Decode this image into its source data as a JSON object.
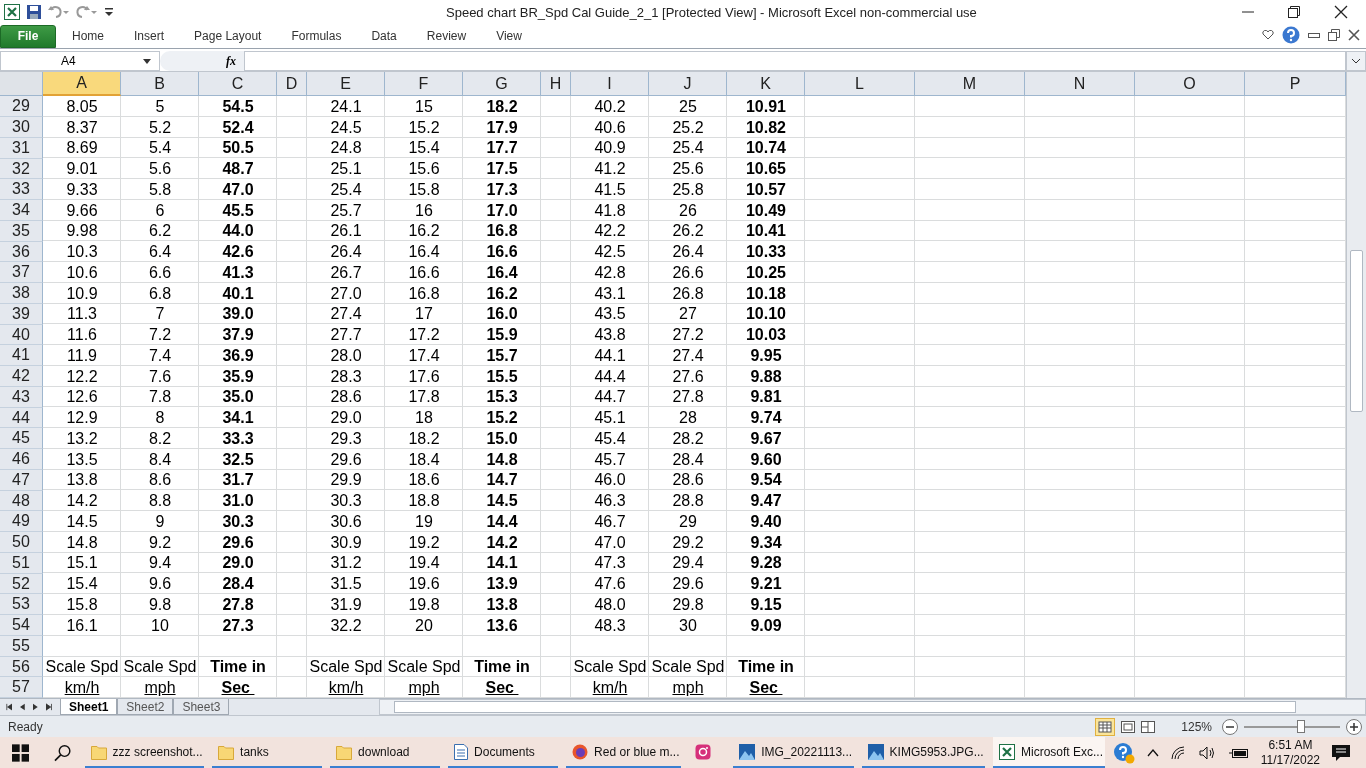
{
  "window": {
    "title": "Speed chart BR_Spd Cal Guide_2_1  [Protected View]  -  Microsoft Excel non-commercial use"
  },
  "ribbon_tabs": [
    {
      "label": "File",
      "kind": "file"
    },
    {
      "label": "Home",
      "kind": "tab"
    },
    {
      "label": "Insert",
      "kind": "tab"
    },
    {
      "label": "Page Layout",
      "kind": "tab"
    },
    {
      "label": "Formulas",
      "kind": "tab"
    },
    {
      "label": "Data",
      "kind": "tab"
    },
    {
      "label": "Review",
      "kind": "tab"
    },
    {
      "label": "View",
      "kind": "tab"
    }
  ],
  "formula_bar": {
    "name_box": "A4",
    "fx": "fx"
  },
  "columns": [
    {
      "label": "A",
      "selected": true
    },
    {
      "label": "B",
      "selected": false
    },
    {
      "label": "C",
      "selected": false
    },
    {
      "label": "D",
      "selected": false
    },
    {
      "label": "E",
      "selected": false
    },
    {
      "label": "F",
      "selected": false
    },
    {
      "label": "G",
      "selected": false
    },
    {
      "label": "H",
      "selected": false
    },
    {
      "label": "I",
      "selected": false
    },
    {
      "label": "J",
      "selected": false
    },
    {
      "label": "K",
      "selected": false
    },
    {
      "label": "L",
      "selected": false
    },
    {
      "label": "M",
      "selected": false
    },
    {
      "label": "N",
      "selected": false
    },
    {
      "label": "O",
      "selected": false
    },
    {
      "label": "P",
      "selected": false
    }
  ],
  "rows": [
    {
      "number": "29",
      "cells": [
        "8.05",
        "5",
        "54.5",
        "24.1",
        "15",
        "18.2",
        "40.2",
        "25",
        "10.91"
      ]
    },
    {
      "number": "30",
      "cells": [
        "8.37",
        "5.2",
        "52.4",
        "24.5",
        "15.2",
        "17.9",
        "40.6",
        "25.2",
        "10.82"
      ]
    },
    {
      "number": "31",
      "cells": [
        "8.69",
        "5.4",
        "50.5",
        "24.8",
        "15.4",
        "17.7",
        "40.9",
        "25.4",
        "10.74"
      ]
    },
    {
      "number": "32",
      "cells": [
        "9.01",
        "5.6",
        "48.7",
        "25.1",
        "15.6",
        "17.5",
        "41.2",
        "25.6",
        "10.65"
      ]
    },
    {
      "number": "33",
      "cells": [
        "9.33",
        "5.8",
        "47.0",
        "25.4",
        "15.8",
        "17.3",
        "41.5",
        "25.8",
        "10.57"
      ]
    },
    {
      "number": "34",
      "cells": [
        "9.66",
        "6",
        "45.5",
        "25.7",
        "16",
        "17.0",
        "41.8",
        "26",
        "10.49"
      ]
    },
    {
      "number": "35",
      "cells": [
        "9.98",
        "6.2",
        "44.0",
        "26.1",
        "16.2",
        "16.8",
        "42.2",
        "26.2",
        "10.41"
      ]
    },
    {
      "number": "36",
      "cells": [
        "10.3",
        "6.4",
        "42.6",
        "26.4",
        "16.4",
        "16.6",
        "42.5",
        "26.4",
        "10.33"
      ]
    },
    {
      "number": "37",
      "cells": [
        "10.6",
        "6.6",
        "41.3",
        "26.7",
        "16.6",
        "16.4",
        "42.8",
        "26.6",
        "10.25"
      ]
    },
    {
      "number": "38",
      "cells": [
        "10.9",
        "6.8",
        "40.1",
        "27.0",
        "16.8",
        "16.2",
        "43.1",
        "26.8",
        "10.18"
      ]
    },
    {
      "number": "39",
      "cells": [
        "11.3",
        "7",
        "39.0",
        "27.4",
        "17",
        "16.0",
        "43.5",
        "27",
        "10.10"
      ]
    },
    {
      "number": "40",
      "cells": [
        "11.6",
        "7.2",
        "37.9",
        "27.7",
        "17.2",
        "15.9",
        "43.8",
        "27.2",
        "10.03"
      ]
    },
    {
      "number": "41",
      "cells": [
        "11.9",
        "7.4",
        "36.9",
        "28.0",
        "17.4",
        "15.7",
        "44.1",
        "27.4",
        "9.95"
      ]
    },
    {
      "number": "42",
      "cells": [
        "12.2",
        "7.6",
        "35.9",
        "28.3",
        "17.6",
        "15.5",
        "44.4",
        "27.6",
        "9.88"
      ]
    },
    {
      "number": "43",
      "cells": [
        "12.6",
        "7.8",
        "35.0",
        "28.6",
        "17.8",
        "15.3",
        "44.7",
        "27.8",
        "9.81"
      ]
    },
    {
      "number": "44",
      "cells": [
        "12.9",
        "8",
        "34.1",
        "29.0",
        "18",
        "15.2",
        "45.1",
        "28",
        "9.74"
      ]
    },
    {
      "number": "45",
      "cells": [
        "13.2",
        "8.2",
        "33.3",
        "29.3",
        "18.2",
        "15.0",
        "45.4",
        "28.2",
        "9.67"
      ]
    },
    {
      "number": "46",
      "cells": [
        "13.5",
        "8.4",
        "32.5",
        "29.6",
        "18.4",
        "14.8",
        "45.7",
        "28.4",
        "9.60"
      ]
    },
    {
      "number": "47",
      "cells": [
        "13.8",
        "8.6",
        "31.7",
        "29.9",
        "18.6",
        "14.7",
        "46.0",
        "28.6",
        "9.54"
      ]
    },
    {
      "number": "48",
      "cells": [
        "14.2",
        "8.8",
        "31.0",
        "30.3",
        "18.8",
        "14.5",
        "46.3",
        "28.8",
        "9.47"
      ]
    },
    {
      "number": "49",
      "cells": [
        "14.5",
        "9",
        "30.3",
        "30.6",
        "19",
        "14.4",
        "46.7",
        "29",
        "9.40"
      ]
    },
    {
      "number": "50",
      "cells": [
        "14.8",
        "9.2",
        "29.6",
        "30.9",
        "19.2",
        "14.2",
        "47.0",
        "29.2",
        "9.34"
      ]
    },
    {
      "number": "51",
      "cells": [
        "15.1",
        "9.4",
        "29.0",
        "31.2",
        "19.4",
        "14.1",
        "47.3",
        "29.4",
        "9.28"
      ]
    },
    {
      "number": "52",
      "cells": [
        "15.4",
        "9.6",
        "28.4",
        "31.5",
        "19.6",
        "13.9",
        "47.6",
        "29.6",
        "9.21"
      ]
    },
    {
      "number": "53",
      "cells": [
        "15.8",
        "9.8",
        "27.8",
        "31.9",
        "19.8",
        "13.8",
        "48.0",
        "29.8",
        "9.15"
      ]
    },
    {
      "number": "54",
      "cells": [
        "16.1",
        "10",
        "27.3",
        "32.2",
        "20",
        "13.6",
        "48.3",
        "30",
        "9.09"
      ]
    },
    {
      "number": "55",
      "cells": []
    },
    {
      "number": "56",
      "underlined": false,
      "cells": [
        "Scale Spd",
        "Scale Spd",
        "Time in",
        "Scale Spd",
        "Scale Spd",
        "Time in",
        "Scale Spd",
        "Scale Spd",
        "Time in"
      ]
    },
    {
      "number": "57",
      "underlined": true,
      "cells": [
        "km/h",
        "mph",
        "Sec ",
        "km/h",
        "mph",
        "Sec ",
        "km/h",
        "mph",
        "Sec "
      ]
    }
  ],
  "sheet_tabs": [
    {
      "label": "Sheet1",
      "selected": true
    },
    {
      "label": "Sheet2",
      "selected": false
    },
    {
      "label": "Sheet3",
      "selected": false
    }
  ],
  "status_bar": {
    "status": "Ready",
    "zoom": "125%",
    "zoom_slider": {
      "level": 0.59
    }
  },
  "taskbar": {
    "items": [
      {
        "label": "zzz screenshot...",
        "kind": "folder",
        "selected": false
      },
      {
        "label": "tanks",
        "kind": "folder",
        "selected": false
      },
      {
        "label": "download",
        "kind": "folder",
        "selected": false
      },
      {
        "label": "Documents",
        "kind": "document",
        "selected": false
      },
      {
        "label": "Red or blue m...",
        "kind": "browser",
        "selected": false
      },
      {
        "kind": "camera",
        "selected": false
      },
      {
        "label": "IMG_20221113...",
        "kind": "image",
        "selected": false
      },
      {
        "label": "KIMG5953.JPG...",
        "kind": "image",
        "selected": false
      },
      {
        "label": "Microsoft Exc...",
        "kind": "excel",
        "selected": true
      }
    ],
    "time": "6:51 AM",
    "date": "11/17/2022"
  }
}
